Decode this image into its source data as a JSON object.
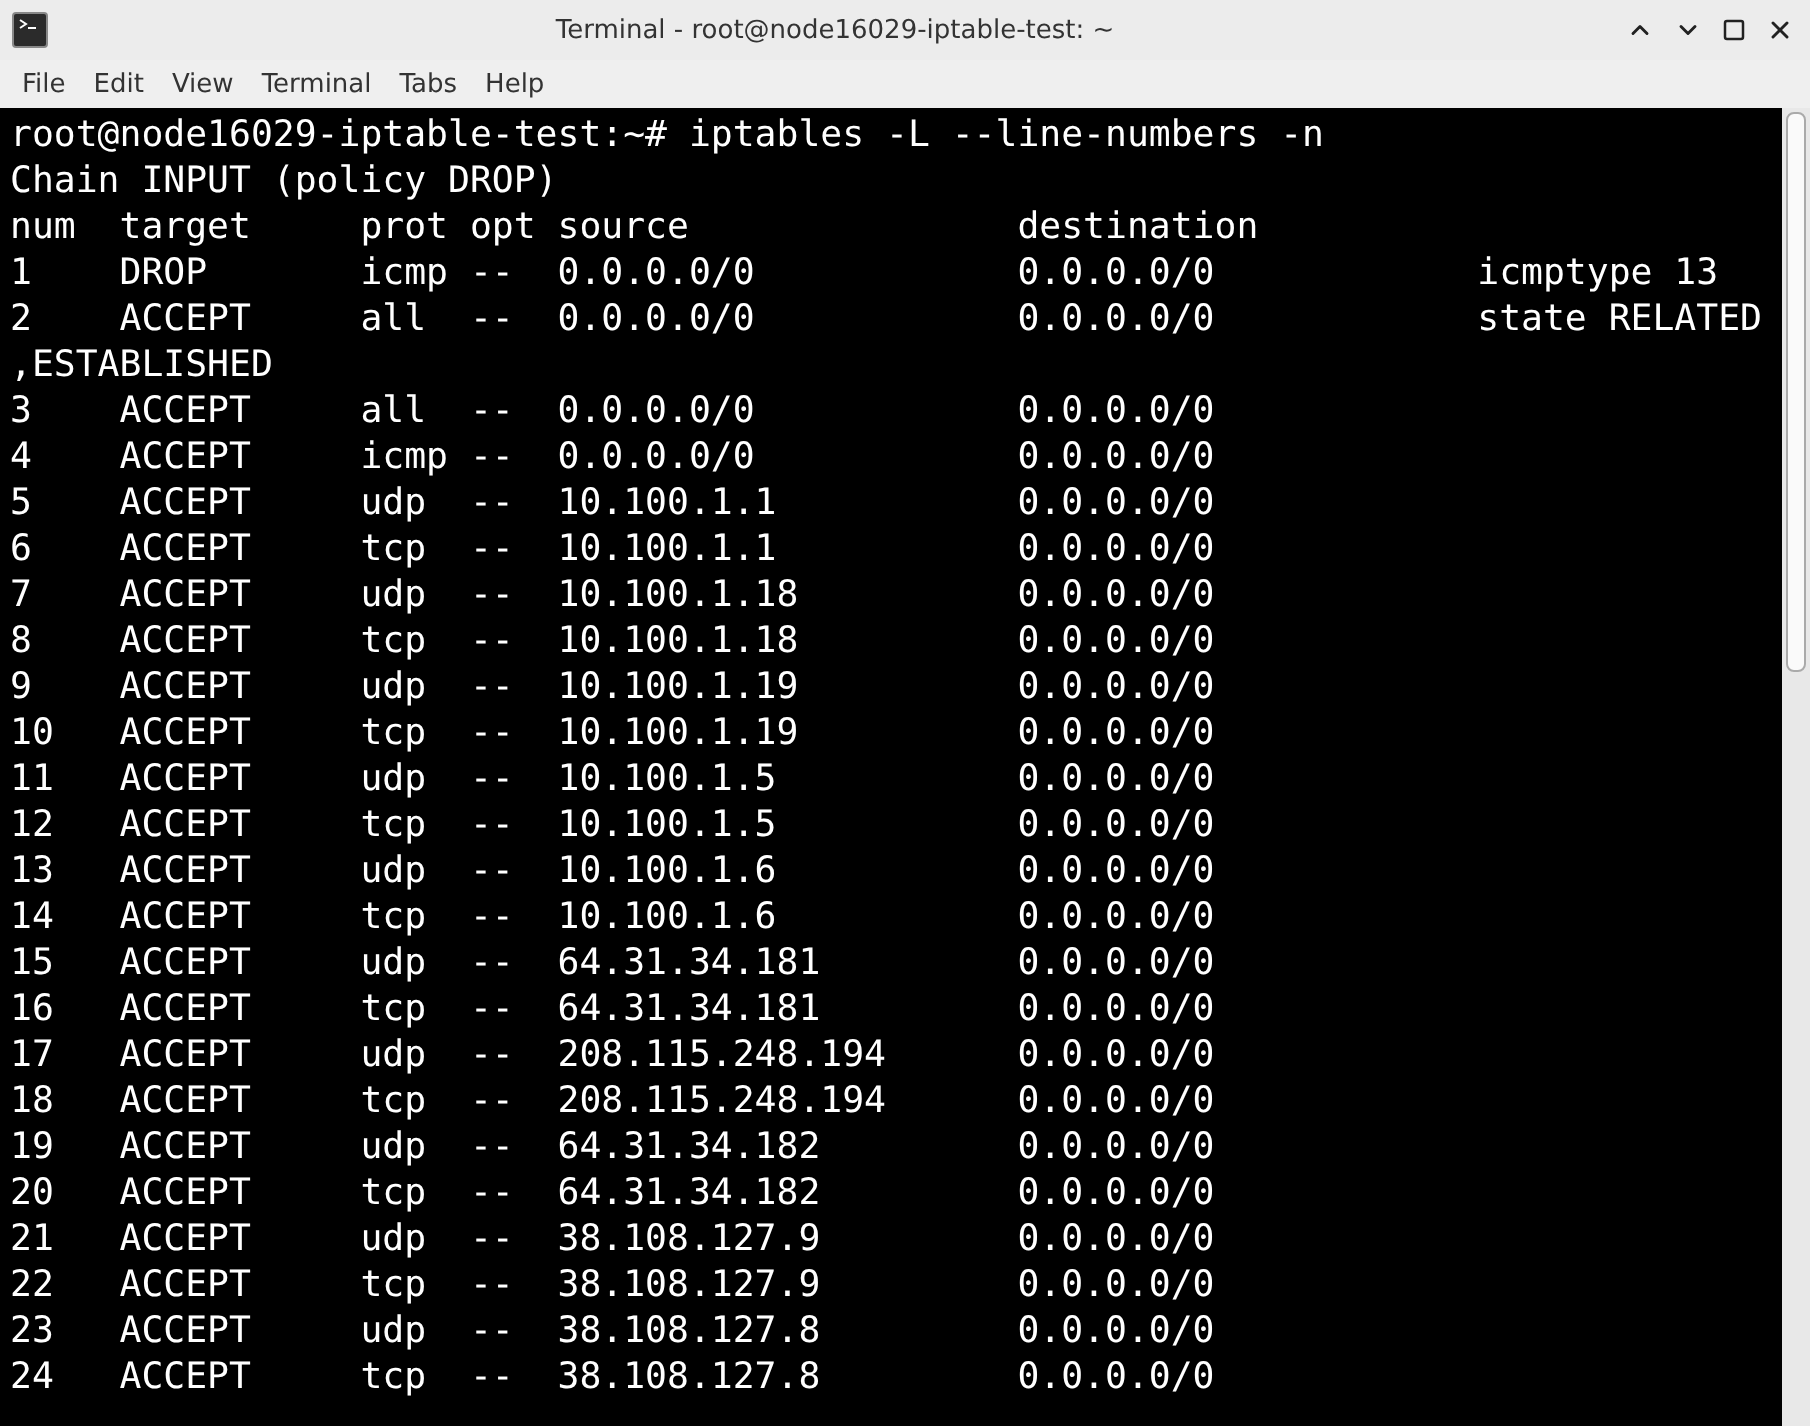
{
  "window": {
    "title": "Terminal - root@node16029-iptable-test: ~"
  },
  "menu": [
    "File",
    "Edit",
    "View",
    "Terminal",
    "Tabs",
    "Help"
  ],
  "terminal": {
    "lines": [
      "root@node16029-iptable-test:~# iptables -L --line-numbers -n",
      "Chain INPUT (policy DROP)",
      "num  target     prot opt source               destination",
      "1    DROP       icmp --  0.0.0.0/0            0.0.0.0/0            icmptype 13",
      "2    ACCEPT     all  --  0.0.0.0/0            0.0.0.0/0            state RELATED",
      ",ESTABLISHED",
      "3    ACCEPT     all  --  0.0.0.0/0            0.0.0.0/0",
      "4    ACCEPT     icmp --  0.0.0.0/0            0.0.0.0/0",
      "5    ACCEPT     udp  --  10.100.1.1           0.0.0.0/0",
      "6    ACCEPT     tcp  --  10.100.1.1           0.0.0.0/0",
      "7    ACCEPT     udp  --  10.100.1.18          0.0.0.0/0",
      "8    ACCEPT     tcp  --  10.100.1.18          0.0.0.0/0",
      "9    ACCEPT     udp  --  10.100.1.19          0.0.0.0/0",
      "10   ACCEPT     tcp  --  10.100.1.19          0.0.0.0/0",
      "11   ACCEPT     udp  --  10.100.1.5           0.0.0.0/0",
      "12   ACCEPT     tcp  --  10.100.1.5           0.0.0.0/0",
      "13   ACCEPT     udp  --  10.100.1.6           0.0.0.0/0",
      "14   ACCEPT     tcp  --  10.100.1.6           0.0.0.0/0",
      "15   ACCEPT     udp  --  64.31.34.181         0.0.0.0/0",
      "16   ACCEPT     tcp  --  64.31.34.181         0.0.0.0/0",
      "17   ACCEPT     udp  --  208.115.248.194      0.0.0.0/0",
      "18   ACCEPT     tcp  --  208.115.248.194      0.0.0.0/0",
      "19   ACCEPT     udp  --  64.31.34.182         0.0.0.0/0",
      "20   ACCEPT     tcp  --  64.31.34.182         0.0.0.0/0",
      "21   ACCEPT     udp  --  38.108.127.9         0.0.0.0/0",
      "22   ACCEPT     tcp  --  38.108.127.9         0.0.0.0/0",
      "23   ACCEPT     udp  --  38.108.127.8         0.0.0.0/0",
      "24   ACCEPT     tcp  --  38.108.127.8         0.0.0.0/0"
    ]
  }
}
